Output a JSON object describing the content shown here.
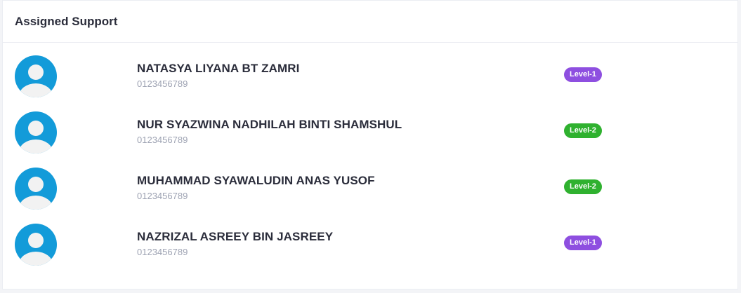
{
  "card": {
    "title": "Assigned Support"
  },
  "colors": {
    "avatar_bg": "#139bd9",
    "level_1": "#8e4fe0",
    "level_2": "#2fb12f"
  },
  "members": [
    {
      "avatar_icon": "user-avatar-icon",
      "name": "NATASYA LIYANA BT ZAMRI",
      "phone": "0123456789",
      "level": "Level-1",
      "level_color": "#8e4fe0"
    },
    {
      "avatar_icon": "user-avatar-icon",
      "name": "NUR SYAZWINA NADHILAH BINTI SHAMSHUL",
      "phone": "0123456789",
      "level": "Level-2",
      "level_color": "#2fb12f"
    },
    {
      "avatar_icon": "user-avatar-icon",
      "name": "MUHAMMAD SYAWALUDIN ANAS YUSOF",
      "phone": "0123456789",
      "level": "Level-2",
      "level_color": "#2fb12f"
    },
    {
      "avatar_icon": "user-avatar-icon",
      "name": "NAZRIZAL ASREEY BIN JASREEY",
      "phone": "0123456789",
      "level": "Level-1",
      "level_color": "#8e4fe0"
    }
  ]
}
